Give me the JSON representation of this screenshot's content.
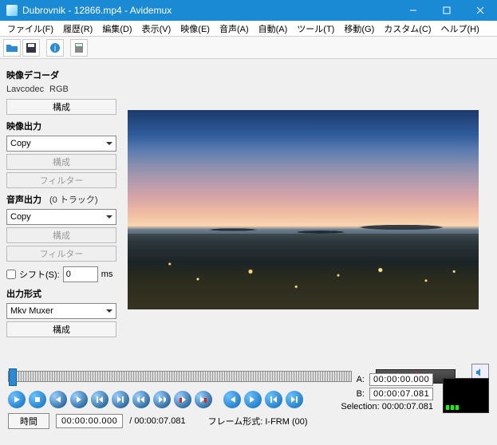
{
  "title": "Dubrovnik - 12866.mp4 - Avidemux",
  "menu": [
    "ファイル(F)",
    "履歴(R)",
    "編集(D)",
    "表示(V)",
    "映像(E)",
    "音声(A)",
    "自動(A)",
    "ツール(T)",
    "移動(G)",
    "カスタム(C)",
    "ヘルプ(H)"
  ],
  "decoder": {
    "title": "映像デコーダ",
    "codec": "Lavcodec",
    "format": "RGB",
    "config": "構成"
  },
  "video_out": {
    "title": "映像出力",
    "copy": "Copy",
    "config": "構成",
    "filters": "フィルター"
  },
  "audio_out": {
    "title": "音声出力",
    "tracks": "(0 トラック)",
    "copy": "Copy",
    "config": "構成",
    "filters": "フィルター",
    "shift_label": "シフト(S):",
    "shift_value": "0",
    "shift_unit": "ms"
  },
  "output_format": {
    "title": "出力形式",
    "muxer": "Mkv Muxer",
    "config": "構成"
  },
  "ab": {
    "a_label": "A:",
    "a_value": "00:00:00.000",
    "b_label": "B:",
    "b_value": "00:00:07.081",
    "selection": "Selection: 00:00:07.081"
  },
  "status": {
    "time_btn": "時間",
    "pos": "00:00:00.000",
    "total": "/ 00:00:07.081",
    "frame_type": "フレーム形式: I-FRM (00)"
  }
}
